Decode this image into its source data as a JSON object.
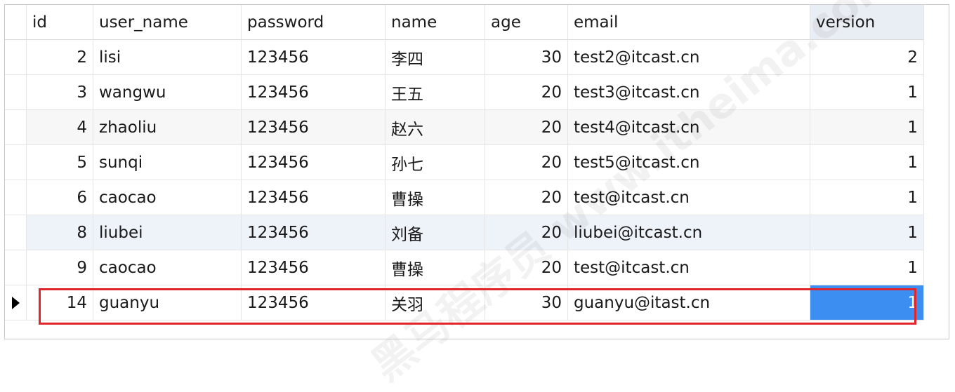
{
  "columns": [
    "id",
    "user_name",
    "password",
    "name",
    "age",
    "email",
    "version"
  ],
  "rows": [
    {
      "id": "2",
      "user_name": "lisi",
      "password": "123456",
      "name": "李四",
      "age": "30",
      "email": "test2@itcast.cn",
      "version": "2"
    },
    {
      "id": "3",
      "user_name": "wangwu",
      "password": "123456",
      "name": "王五",
      "age": "20",
      "email": "test3@itcast.cn",
      "version": "1"
    },
    {
      "id": "4",
      "user_name": "zhaoliu",
      "password": "123456",
      "name": "赵六",
      "age": "20",
      "email": "test4@itcast.cn",
      "version": "1"
    },
    {
      "id": "5",
      "user_name": "sunqi",
      "password": "123456",
      "name": "孙七",
      "age": "20",
      "email": "test5@itcast.cn",
      "version": "1"
    },
    {
      "id": "6",
      "user_name": "caocao",
      "password": "123456",
      "name": "曹操",
      "age": "20",
      "email": "test@itcast.cn",
      "version": "1"
    },
    {
      "id": "8",
      "user_name": "liubei",
      "password": "123456",
      "name": "刘备",
      "age": "20",
      "email": "liubei@itcast.cn",
      "version": "1"
    },
    {
      "id": "9",
      "user_name": "caocao",
      "password": "123456",
      "name": "曹操",
      "age": "20",
      "email": "test@itcast.cn",
      "version": "1"
    },
    {
      "id": "14",
      "user_name": "guanyu",
      "password": "123456",
      "name": "关羽",
      "age": "30",
      "email": "guanyu@itast.cn",
      "version": "1"
    }
  ],
  "current_row_index": 7,
  "selected_column": "version",
  "watermark": "黑马程序员 www.itheima.com",
  "colors": {
    "selection": "#3c8ff0",
    "highlight_border": "#e0262b",
    "sorted_header": "#e9edf4"
  }
}
